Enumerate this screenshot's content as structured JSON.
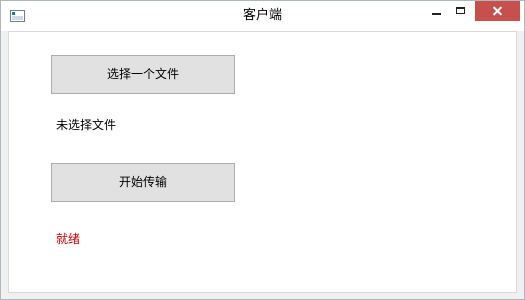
{
  "window": {
    "title": "客户端",
    "controls": [
      "minimize-icon",
      "maximize-icon",
      "close-icon"
    ],
    "close_color": "#c7504c"
  },
  "main": {
    "select_file_button": "选择一个文件",
    "file_label": "未选择文件",
    "start_button": "开始传输",
    "status": "就绪",
    "status_color": "#cc0000"
  }
}
